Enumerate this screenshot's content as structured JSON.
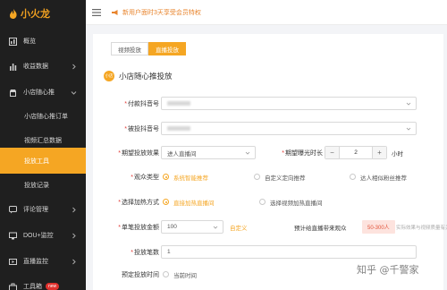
{
  "logo": {
    "text": "小火龙",
    "color": "#f5a623"
  },
  "sidebar": {
    "items": [
      {
        "label": "概览",
        "icon": "dashboard-icon"
      },
      {
        "label": "收益数据",
        "icon": "bar-chart-icon"
      },
      {
        "label": "小店随心推",
        "icon": "shop-icon"
      },
      {
        "label": "小店随心推订单"
      },
      {
        "label": "视频汇总数据"
      },
      {
        "label": "投放工具"
      },
      {
        "label": "投放记录"
      },
      {
        "label": "评论管理",
        "icon": "comment-icon"
      },
      {
        "label": "DOU+监控",
        "icon": "monitor-icon"
      },
      {
        "label": "直播监控",
        "icon": "live-icon"
      },
      {
        "label": "工具箱",
        "icon": "toolbox-icon",
        "badge": "new"
      }
    ]
  },
  "topbar": {
    "notice": "新用户面时3天享受会员特权"
  },
  "tabs": [
    {
      "label": "视频投放"
    },
    {
      "label": "直播投放"
    }
  ],
  "section": {
    "dot": "小店",
    "title": "小店随心推投放"
  },
  "form": {
    "payer": {
      "label": "付款抖音号"
    },
    "target": {
      "label": "被投抖音号"
    },
    "goal": {
      "label": "期望投放效果",
      "value": "进人直播间"
    },
    "duration": {
      "label": "期望曝光时长",
      "value": "2",
      "minus": "−",
      "plus": "+",
      "unit": "小时"
    },
    "audience": {
      "label": "观众类型",
      "options": [
        "系统智能推荐",
        "自定义定向推荐",
        "达人相似粉丝推荐"
      ]
    },
    "method": {
      "label": "选择加热方式",
      "options": [
        "直接加热直播间",
        "选择视频加热直播间"
      ]
    },
    "amount": {
      "label": "单笔投放金额",
      "value": "100",
      "custom": "自定义",
      "estimate_label": "预计给直播带来观众",
      "estimate": "50-300人",
      "hint": "实际效果与视频质量有关"
    },
    "count": {
      "label": "投放笔数",
      "value": "1"
    },
    "schedule": {
      "label": "预定投放时间",
      "option": "当前时间"
    }
  },
  "watermark": "知乎 @千警家"
}
